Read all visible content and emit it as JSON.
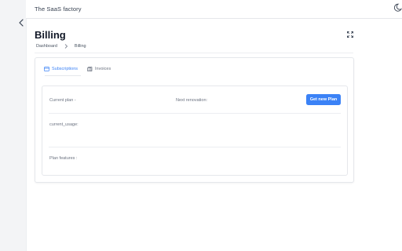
{
  "app": {
    "brand": "The SaaS factory"
  },
  "page": {
    "title": "Billing",
    "breadcrumb": [
      "Dashboard",
      "Billing"
    ]
  },
  "tabs": [
    {
      "label": "Subscriptions",
      "active": true,
      "icon": "card-icon"
    },
    {
      "label": "Invoices",
      "active": false,
      "icon": "invoice-icon"
    }
  ],
  "subscription": {
    "current_plan_label": "Current plan -",
    "next_renovation_label": "Next renovation:",
    "get_plan_button": "Get new Plan",
    "current_usage_label": "current_usage:",
    "plan_features_label": "Plan features :"
  },
  "colors": {
    "accent": "#3b82f6",
    "sidebar": "#f3f4f6"
  }
}
